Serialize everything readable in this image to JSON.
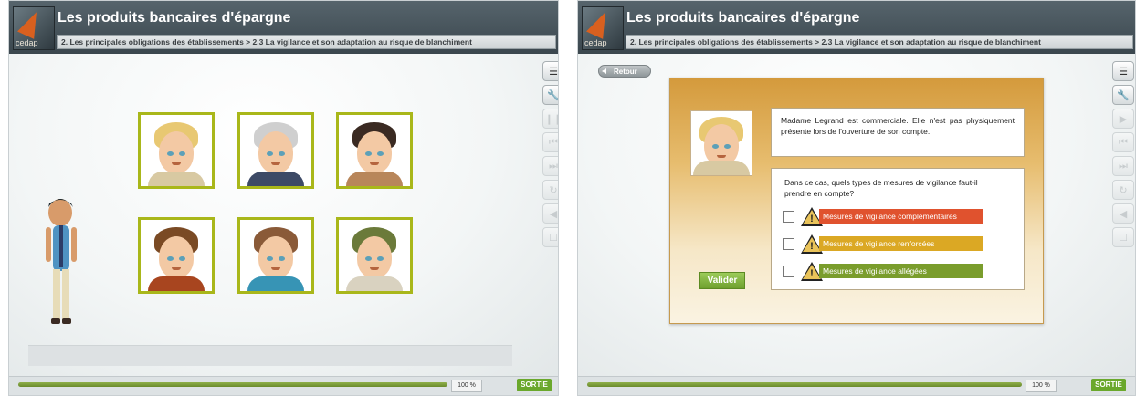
{
  "app_title": "Les produits bancaires d'épargne",
  "logo_text": "cedap",
  "breadcrumb": "2. Les principales obligations des établissements > 2.3 La vigilance et son adaptation au risque de blanchiment",
  "footer": {
    "progress_percent": 100,
    "percent_label": "100 %",
    "sortie_label": "SORTIE"
  },
  "toolbar_left": [
    {
      "icon": "menu-icon",
      "glyph": "☰",
      "enabled": true
    },
    {
      "icon": "wrench-icon",
      "glyph": "🔧",
      "enabled": true
    },
    {
      "icon": "pause-icon",
      "glyph": "❙❙",
      "enabled": false
    },
    {
      "icon": "skip-back-icon",
      "glyph": "⏮",
      "enabled": false
    },
    {
      "icon": "skip-forward-icon",
      "glyph": "⏭",
      "enabled": false
    },
    {
      "icon": "replay-icon",
      "glyph": "↻",
      "enabled": false
    },
    {
      "icon": "sound-icon",
      "glyph": "◀",
      "enabled": false
    },
    {
      "icon": "subtitles-icon",
      "glyph": "☐",
      "enabled": false
    }
  ],
  "toolbar_right": [
    {
      "icon": "menu-icon",
      "glyph": "☰",
      "enabled": true
    },
    {
      "icon": "wrench-icon",
      "glyph": "🔧",
      "enabled": true
    },
    {
      "icon": "play-icon",
      "glyph": "▶",
      "enabled": false
    },
    {
      "icon": "skip-back-icon",
      "glyph": "⏮",
      "enabled": false
    },
    {
      "icon": "skip-forward-icon",
      "glyph": "⏭",
      "enabled": false
    },
    {
      "icon": "replay-icon",
      "glyph": "↻",
      "enabled": false
    },
    {
      "icon": "sound-icon",
      "glyph": "◀",
      "enabled": false
    },
    {
      "icon": "subtitles-icon",
      "glyph": "☐",
      "enabled": false
    }
  ],
  "avatars": [
    {
      "hair": "#e8c872",
      "torso": "#d8c9a2"
    },
    {
      "hair": "#cfcfcf",
      "torso": "#3d4a66"
    },
    {
      "hair": "#3a2a22",
      "torso": "#b8865a"
    },
    {
      "hair": "#7a4a24",
      "torso": "#a8451f"
    },
    {
      "hair": "#8a5a38",
      "torso": "#3794b5"
    },
    {
      "hair": "#6b7a3a",
      "torso": "#d9d2c0"
    }
  ],
  "retour_label": "Retour",
  "scenario_text": "Madame Legrand est commerciale. Elle n'est pas physiquement présente lors de l'ouverture de son compte.",
  "question": "Dans ce cas, quels types de mesures de vigilance faut-il prendre en compte?",
  "options": [
    {
      "label": "Mesures de vigilance complémentaires",
      "color": "#e0522e"
    },
    {
      "label": "Mesures de vigilance renforcées",
      "color": "#dba824"
    },
    {
      "label": "Mesures de vigilance allégées",
      "color": "#7a9d2c"
    }
  ],
  "valider_label": "Valider"
}
